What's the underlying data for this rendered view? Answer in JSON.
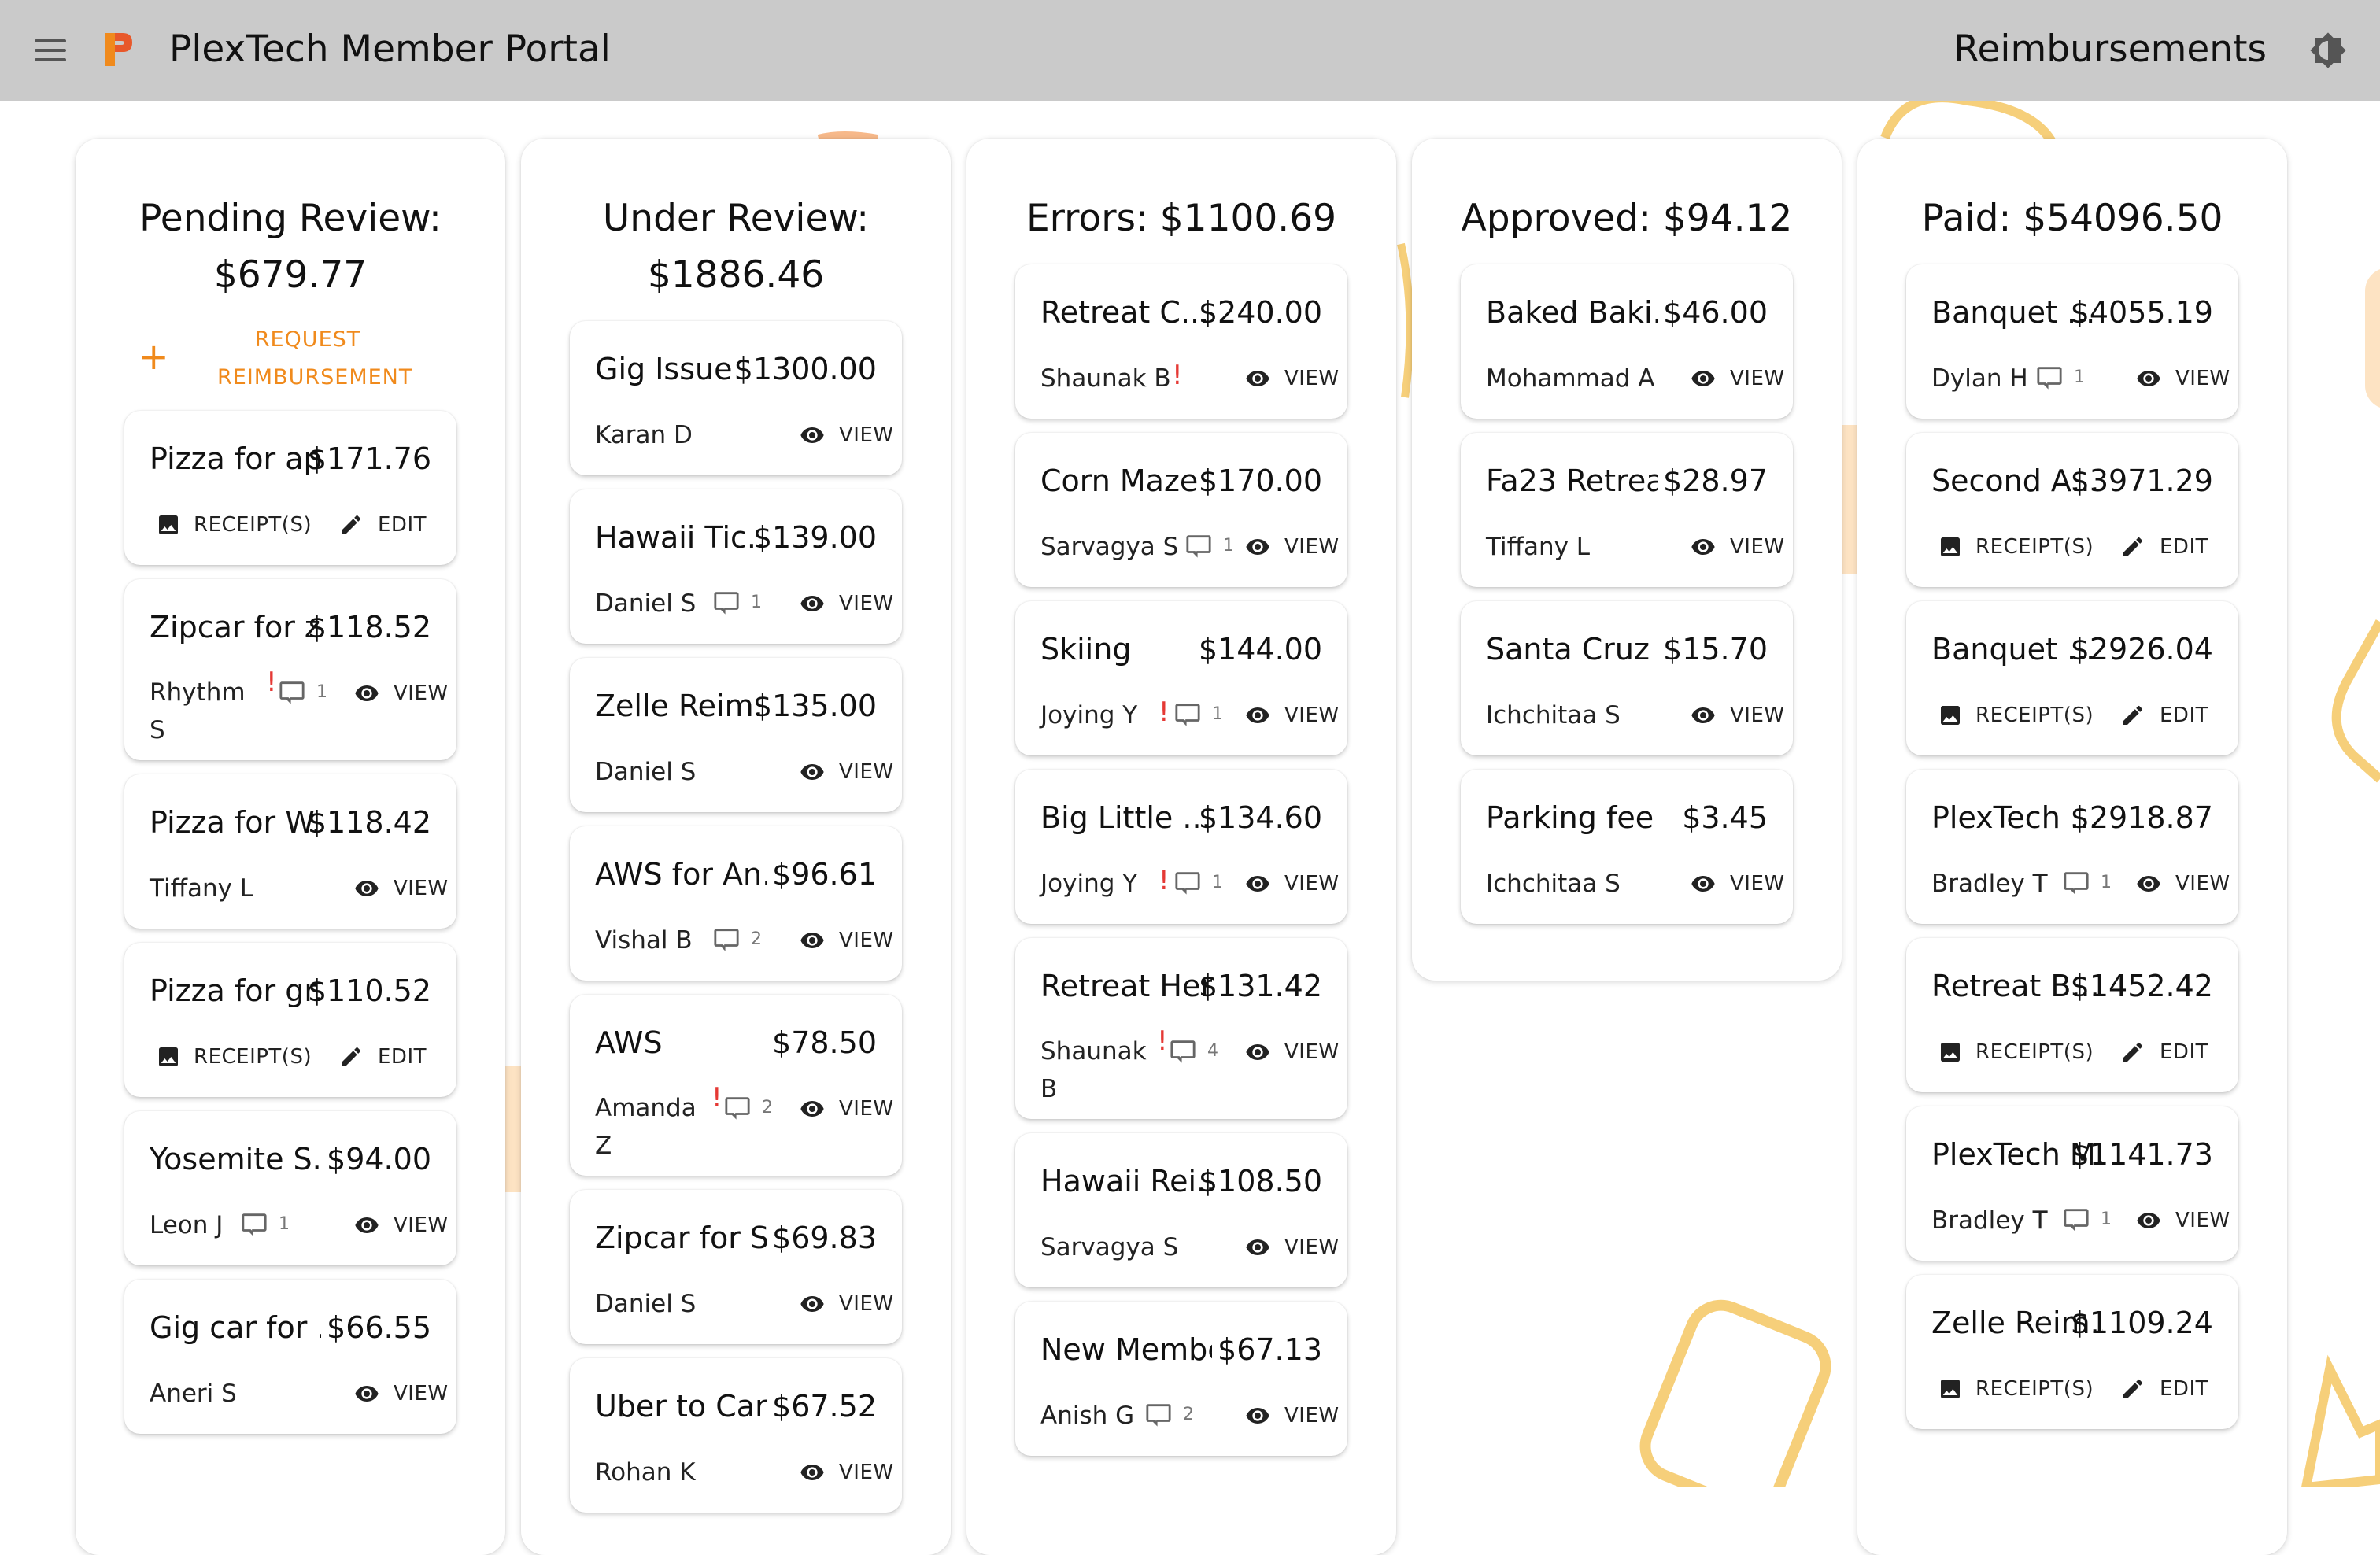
{
  "header": {
    "app_title": "PlexTech Member Portal",
    "page_title": "Reimbursements",
    "accent_color": "#f08a1c"
  },
  "icons": {
    "menu": "hamburger-menu-icon",
    "logo": "plextech-logo",
    "theme": "brightness-icon",
    "view": "eye-icon",
    "comment": "comment-icon",
    "receipt": "image-icon",
    "edit": "pencil-icon",
    "add": "plus-icon"
  },
  "actions": {
    "view": "VIEW",
    "receipts": "RECEIPT(S)",
    "edit": "EDIT"
  },
  "columns": [
    {
      "title": "Pending Review: $679.77",
      "request_label": "REQUEST REIMBURSEMENT",
      "request_icon": "+",
      "cards": [
        {
          "title": "Pizza for ap...",
          "amount": "$171.76",
          "mode": "edit"
        },
        {
          "title": "Zipcar for z...",
          "amount": "$118.52",
          "submitter": "Rhythm S",
          "flag": "!",
          "comments": "1",
          "mode": "view"
        },
        {
          "title": "Pizza for W...",
          "amount": "$118.42",
          "submitter": "Tiffany L",
          "mode": "view"
        },
        {
          "title": "Pizza for gr...",
          "amount": "$110.52",
          "mode": "edit"
        },
        {
          "title": "Yosemite S...",
          "amount": "$94.00",
          "submitter": "Leon J",
          "comments": "1",
          "mode": "view"
        },
        {
          "title": "Gig car for ...",
          "amount": "$66.55",
          "submitter": "Aneri S",
          "mode": "view"
        }
      ]
    },
    {
      "title": "Under Review: $1886.46",
      "cards": [
        {
          "title": "Gig Issue",
          "amount": "$1300.00",
          "submitter": "Karan D",
          "mode": "view"
        },
        {
          "title": "Hawaii Tic...",
          "amount": "$139.00",
          "submitter": "Daniel S",
          "comments": "1",
          "mode": "view"
        },
        {
          "title": "Zelle Reim...",
          "amount": "$135.00",
          "submitter": "Daniel S",
          "mode": "view"
        },
        {
          "title": "AWS for An...",
          "amount": "$96.61",
          "submitter": "Vishal B",
          "comments": "2",
          "mode": "view"
        },
        {
          "title": "AWS",
          "amount": "$78.50",
          "submitter": "Amanda Z",
          "flag": "!",
          "comments": "2",
          "mode": "view"
        },
        {
          "title": "Zipcar for S...",
          "amount": "$69.83",
          "submitter": "Daniel S",
          "mode": "view"
        },
        {
          "title": "Uber to Car...",
          "amount": "$67.52",
          "submitter": "Rohan K",
          "mode": "view"
        }
      ]
    },
    {
      "title": "Errors: $1100.69",
      "cards": [
        {
          "title": "Retreat C...",
          "amount": "$240.00",
          "submitter": "Shaunak B",
          "flag": "!",
          "mode": "view"
        },
        {
          "title": "Corn Maze",
          "amount": "$170.00",
          "submitter": "Sarvagya S",
          "comments": "1",
          "mode": "view"
        },
        {
          "title": "Skiing",
          "amount": "$144.00",
          "submitter": "Joying Y",
          "flag": "!",
          "comments": "1",
          "mode": "view"
        },
        {
          "title": "Big Little ...",
          "amount": "$134.60",
          "submitter": "Joying Y",
          "flag": "!",
          "comments": "1",
          "mode": "view"
        },
        {
          "title": "Retreat Her...",
          "amount": "$131.42",
          "submitter": "Shaunak B",
          "flag": "!",
          "comments": "4",
          "mode": "view"
        },
        {
          "title": "Hawaii Rei...",
          "amount": "$108.50",
          "submitter": "Sarvagya S",
          "mode": "view"
        },
        {
          "title": "New Membe...",
          "amount": "$67.13",
          "submitter": "Anish G",
          "comments": "2",
          "mode": "view"
        }
      ]
    },
    {
      "title": "Approved: $94.12",
      "cards": [
        {
          "title": "Baked Baki...",
          "amount": "$46.00",
          "submitter": "Mohammad A",
          "mode": "view"
        },
        {
          "title": "Fa23 Retrea...",
          "amount": "$28.97",
          "submitter": "Tiffany L",
          "mode": "view"
        },
        {
          "title": "Santa Cruz ...",
          "amount": "$15.70",
          "submitter": "Ichchitaa S",
          "mode": "view"
        },
        {
          "title": "Parking fee f...",
          "amount": "$3.45",
          "submitter": "Ichchitaa S",
          "mode": "view"
        }
      ]
    },
    {
      "title": "Paid: $54096.50",
      "cards": [
        {
          "title": "Banquet ...",
          "amount": "$4055.19",
          "submitter": "Dylan H",
          "comments": "1",
          "mode": "view"
        },
        {
          "title": "Second A...",
          "amount": "$3971.29",
          "mode": "edit"
        },
        {
          "title": "Banquet ...",
          "amount": "$2926.04",
          "mode": "edit"
        },
        {
          "title": "PlexTech ...",
          "amount": "$2918.87",
          "submitter": "Bradley T",
          "comments": "1",
          "mode": "view"
        },
        {
          "title": "Retreat B...",
          "amount": "$1452.42",
          "mode": "edit"
        },
        {
          "title": "PlexTech M...",
          "amount": "$1141.73",
          "submitter": "Bradley T",
          "comments": "1",
          "mode": "view"
        },
        {
          "title": "Zelle Reim...",
          "amount": "$1109.24",
          "mode": "edit"
        }
      ]
    }
  ]
}
